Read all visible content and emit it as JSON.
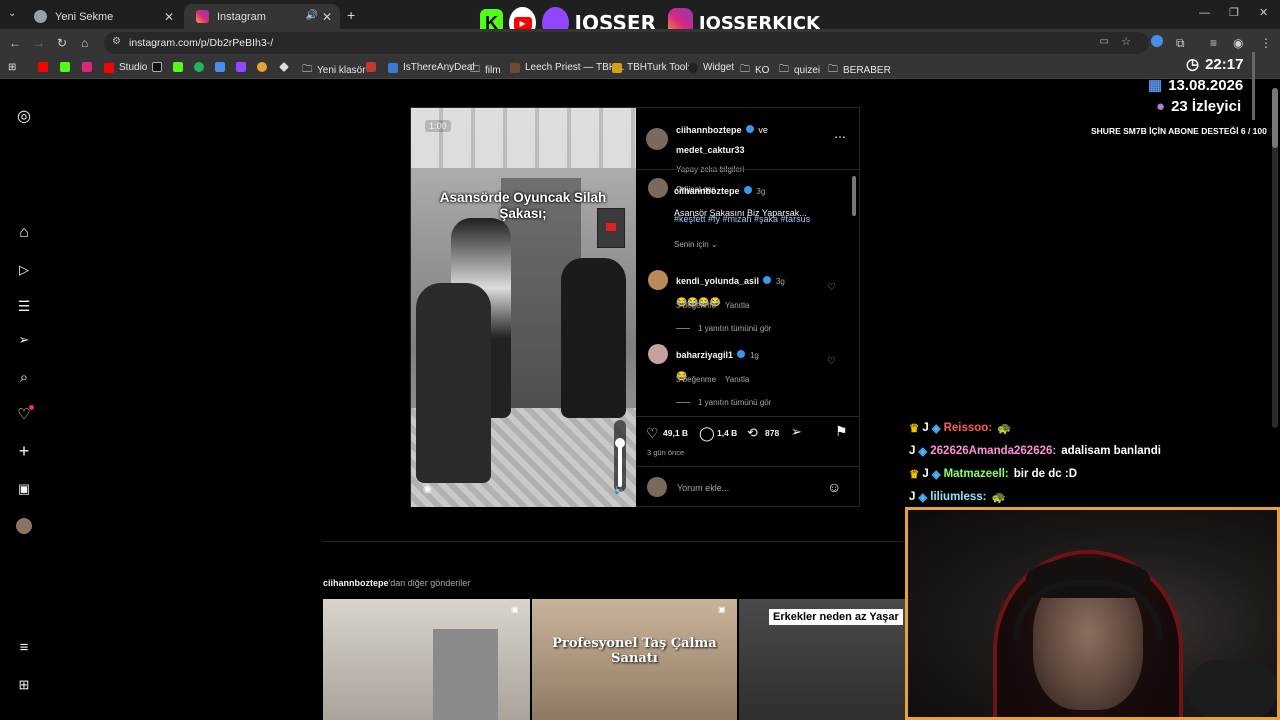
{
  "browser": {
    "tabs": [
      {
        "label": "Yeni Sekme",
        "active": false
      },
      {
        "label": "Instagram",
        "active": true
      }
    ],
    "url": "instagram.com/p/Db2rPeBIh3-/",
    "bookmarks": [
      "Studio",
      "Yeni klasör",
      "IsThereAnyDeal",
      "film",
      "Leech Priest — TBH...",
      "TBHTurk Tools",
      "Widget",
      "KO",
      "quizei",
      "BERABER"
    ]
  },
  "overlay": {
    "channel_twitch": "JOSSER",
    "channel_kick": "JOSSERKICK",
    "time": "22:17",
    "date": "13.08.2026",
    "viewers": "23 İzleyici",
    "goal": "SHURE SM7B İÇİN ABONE DESTEĞİ 6 / 100"
  },
  "post": {
    "video_caption": "Asansörde Oyuncak Silah Şakası;",
    "video_time": "1:00",
    "author": "ciihannboztepe",
    "coauthor_join": "ve",
    "coauthor": "medet_caktur33",
    "ai_label": "Yapay zeka bilgileri",
    "audio": "Orijinal ses",
    "caption_user": "ciihannboztepe",
    "caption_age": "3g",
    "caption_text": "Asansör Şakasını Biz Yaparsak...",
    "hashtags": "#keşfett #fy #mizah #şaka #tarsus",
    "for_you": "Senin için",
    "comments": [
      {
        "user": "kendi_yolunda_asil",
        "age": "3g",
        "text": "😂😂😂😂",
        "likes": "3 beğenme",
        "reply": "Yanıtla",
        "view_replies": "1 yanıtın tümünü gör"
      },
      {
        "user": "baharziyagil1",
        "age": "1g",
        "text": "😂",
        "likes": "3 beğenme",
        "reply": "Yanıtla",
        "view_replies": "1 yanıtın tümünü gör"
      }
    ],
    "likes": "49,1 B",
    "comment_count": "1,4 B",
    "reposts": "878",
    "posted": "3 gün önce",
    "comment_placeholder": "Yorum ekle..."
  },
  "more_posts": {
    "title_user": "ciihannboztepe",
    "title_suffix": "'dan diğer gönderiler",
    "thumbs": [
      {
        "caption": ""
      },
      {
        "caption": "Profesyonel Taş Çalma Sanatı"
      },
      {
        "caption": "Erkekler neden az Yaşar"
      }
    ]
  },
  "chat": [
    {
      "user": "Reissoo:",
      "color": "#ff5a5a",
      "msg": "🐢"
    },
    {
      "user": "262626Amanda262626:",
      "color": "#ff8fd8",
      "msg": "adalisam banlandi"
    },
    {
      "user": "Matmazeell:",
      "color": "#8cff6a",
      "msg": "bir de dc :D"
    },
    {
      "user": "liliumless:",
      "color": "#8ce3ff",
      "msg": "🐢"
    }
  ]
}
